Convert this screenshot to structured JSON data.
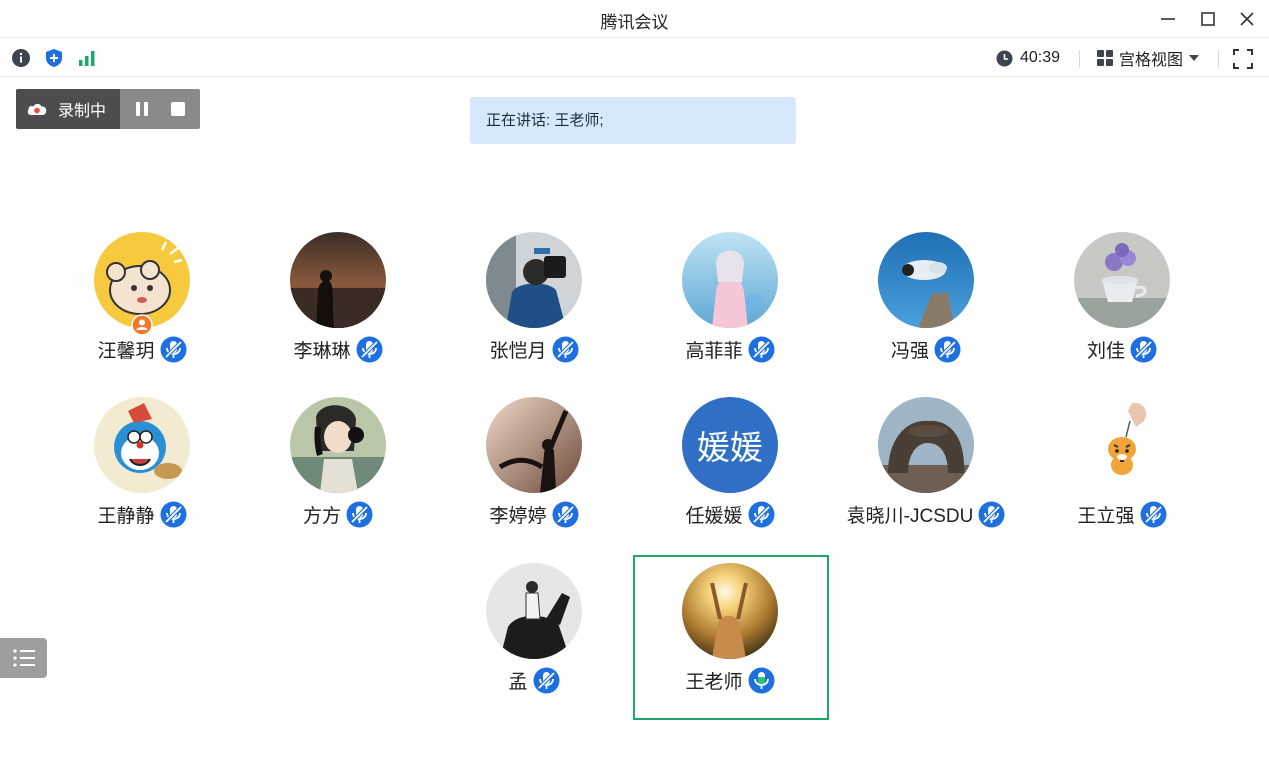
{
  "window": {
    "title": "腾讯会议"
  },
  "toolbar": {
    "timer": "40:39",
    "view_mode": "宫格视图"
  },
  "recording": {
    "label": "录制中"
  },
  "speaking_banner": "正在讲话: 王老师;",
  "participants": [
    {
      "name": "汪馨玥",
      "host": true
    },
    {
      "name": "李琳琳"
    },
    {
      "name": "张恺月"
    },
    {
      "name": "高菲菲"
    },
    {
      "name": "冯强"
    },
    {
      "name": "刘佳"
    },
    {
      "name": "王静静"
    },
    {
      "name": "方方"
    },
    {
      "name": "李婷婷"
    },
    {
      "name": "任媛媛",
      "avatar_text": "媛媛"
    },
    {
      "name": "袁晓川-JCSDU"
    },
    {
      "name": "王立强"
    },
    {
      "name": "孟"
    },
    {
      "name": "王老师",
      "speaking": true
    }
  ],
  "colors": {
    "accent_blue": "#1e6fe0",
    "speaking_green": "#1aa968",
    "banner_bg": "#d7e8fc"
  }
}
